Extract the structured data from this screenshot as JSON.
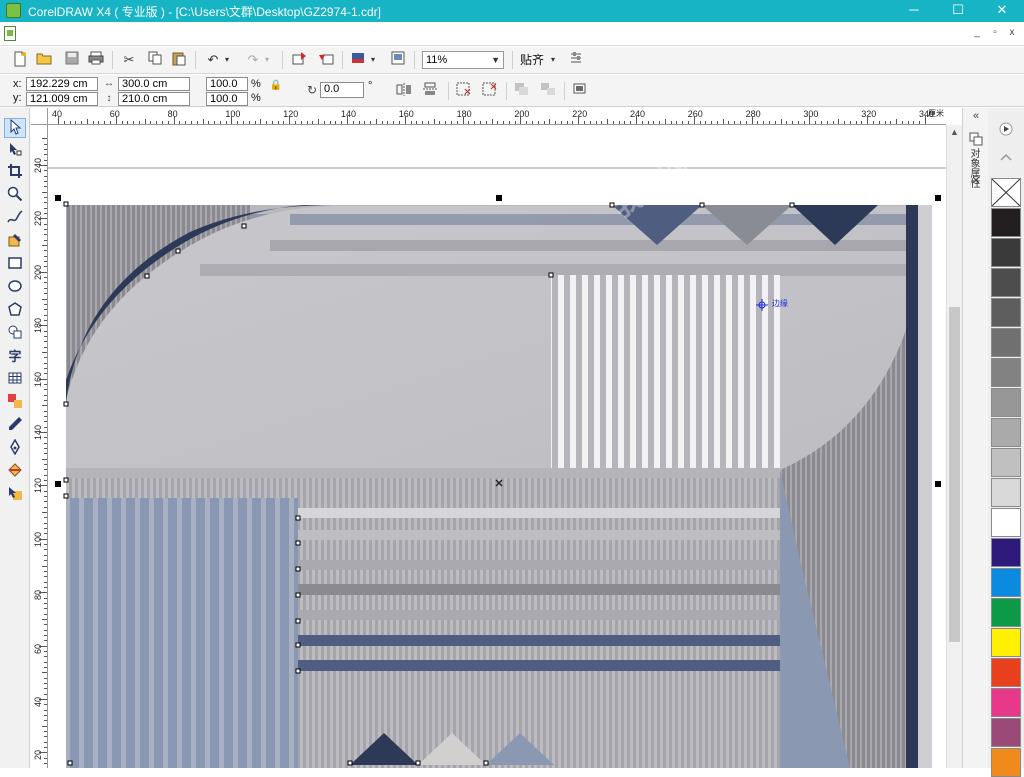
{
  "window": {
    "title": "CorelDRAW X4 ( 专业版 ) - [C:\\Users\\文群\\Desktop\\GZ2974-1.cdr]",
    "controls": [
      "─",
      "☐",
      "✕"
    ]
  },
  "mdi_controls": [
    "_",
    "▫",
    "x"
  ],
  "standard_toolbar": {
    "zoom_value": "11%",
    "snap_label": "贴齐",
    "icons": [
      "new-icon",
      "open-icon",
      "save-icon",
      "print-icon",
      "cut-icon",
      "copy-icon",
      "paste-icon",
      "undo-icon",
      "redo-icon",
      "import-icon",
      "export-icon",
      "application-launcher-icon",
      "welcome-screen-icon",
      "options-icon"
    ]
  },
  "property_bar": {
    "x_label": "x:",
    "y_label": "y:",
    "x_value": "192.229 cm",
    "y_value": "121.009 cm",
    "width_value": "300.0 cm",
    "height_value": "210.0 cm",
    "scale_x": "100.0",
    "scale_y": "100.0",
    "percent": "%",
    "rotation": "0.0",
    "degree": "°"
  },
  "toolbox": {
    "tools": [
      "pick-tool-icon",
      "shape-tool-icon",
      "crop-tool-icon",
      "zoom-tool-icon",
      "freehand-tool-icon",
      "smart-fill-tool-icon",
      "rectangle-tool-icon",
      "ellipse-tool-icon",
      "polygon-tool-icon",
      "basic-shapes-tool-icon",
      "text-tool-icon",
      "table-tool-icon",
      "interactive-blend-tool-icon",
      "eyedropper-tool-icon",
      "outline-tool-icon",
      "fill-tool-icon",
      "interactive-fill-tool-icon"
    ],
    "text_tool_glyph": "字"
  },
  "rulers": {
    "horizontal_labels": [
      "40",
      "60",
      "80",
      "100",
      "120",
      "140",
      "160",
      "180",
      "200",
      "220",
      "240",
      "260",
      "280",
      "300",
      "320",
      "340"
    ],
    "horizontal_unit": "厘米",
    "vertical_labels": [
      "240",
      "220",
      "200",
      "180",
      "160",
      "140",
      "120",
      "100",
      "80",
      "60",
      "40",
      "20"
    ]
  },
  "canvas": {
    "cursor_label": "边缘",
    "watermark": "我图网"
  },
  "docker": {
    "tab_label": "对象属性"
  },
  "palette": {
    "colors": [
      "#231f20",
      "#3a3a3a",
      "#4d4d4d",
      "#5e5e5e",
      "#707070",
      "#828282",
      "#969696",
      "#aaaaaa",
      "#c0c0c0",
      "#d9d9d9",
      "#ffffff",
      "#2e1a7a",
      "#0a8be0",
      "#0c9a48",
      "#fff000",
      "#e8401c",
      "#e8388a",
      "#9b4a78",
      "#f08a1c"
    ]
  }
}
